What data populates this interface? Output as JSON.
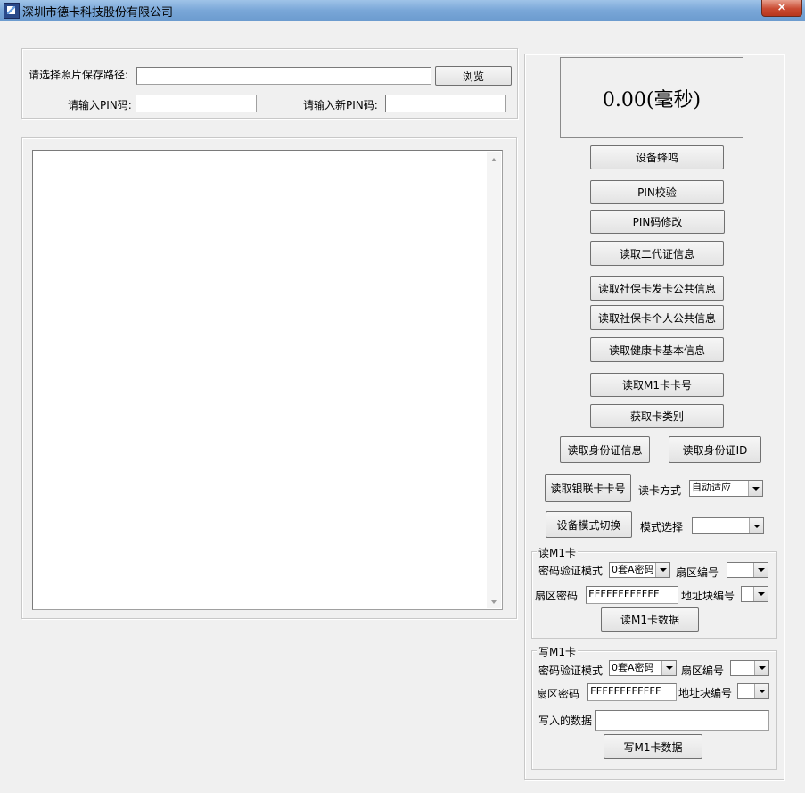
{
  "window": {
    "title": "深圳市德卡科技股份有限公司",
    "close_label": "×"
  },
  "top": {
    "photo_path_label": "请选择照片保存路径:",
    "photo_path_value": "",
    "browse_label": "浏览",
    "pin_label": "请输入PIN码:",
    "pin_value": "",
    "new_pin_label": "请输入新PIN码:",
    "new_pin_value": ""
  },
  "output": {
    "text": ""
  },
  "timer": {
    "display": "0.00(毫秒)"
  },
  "buttons": {
    "beep": "设备蜂鸣",
    "pin_verify": "PIN校验",
    "pin_modify": "PIN码修改",
    "read_second_gen_id": "读取二代证信息",
    "read_social_issuer": "读取社保卡发卡公共信息",
    "read_social_personal": "读取社保卡个人公共信息",
    "read_health_basic": "读取健康卡基本信息",
    "read_m1_card_no": "读取M1卡卡号",
    "get_card_type": "获取卡类别",
    "read_id_info": "读取身份证信息",
    "read_id_id": "读取身份证ID",
    "read_unionpay_no": "读取银联卡卡号",
    "device_mode_switch": "设备模式切换"
  },
  "read_mode": {
    "label": "读卡方式",
    "value": "自动适应"
  },
  "mode_select": {
    "label": "模式选择",
    "value": ""
  },
  "read_m1": {
    "title": "读M1卡",
    "auth_mode_label": "密码验证模式",
    "auth_mode_value": "0套A密码",
    "sector_label": "扇区编号",
    "sector_value": "",
    "sector_pwd_label": "扇区密码",
    "sector_pwd_value": "FFFFFFFFFFFF",
    "block_label": "地址块编号",
    "block_value": "",
    "action": "读M1卡数据"
  },
  "write_m1": {
    "title": "写M1卡",
    "auth_mode_label": "密码验证模式",
    "auth_mode_value": "0套A密码",
    "sector_label": "扇区编号",
    "sector_value": "",
    "sector_pwd_label": "扇区密码",
    "sector_pwd_value": "FFFFFFFFFFFF",
    "block_label": "地址块编号",
    "block_value": "",
    "data_label": "写入的数据",
    "data_value": "",
    "action": "写M1卡数据"
  }
}
